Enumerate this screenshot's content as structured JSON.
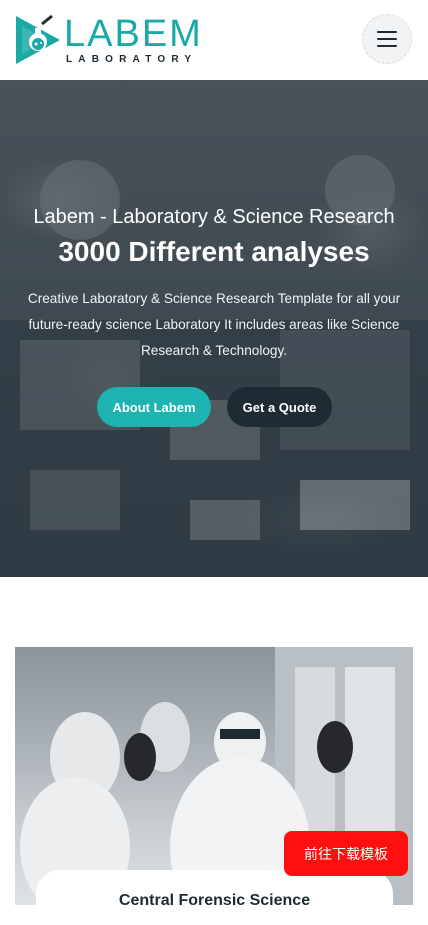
{
  "header": {
    "logo_word": "LABEM",
    "logo_sub": "LABORATORY",
    "brand_color": "#1aa9a6",
    "menu_icon": "hamburger-menu-icon"
  },
  "hero": {
    "subtitle": "Labem - Laboratory & Science Research",
    "title": "3000 Different analyses",
    "description": "Creative Laboratory & Science Research Template for all your future-ready science Laboratory It includes areas like Science Research & Technology.",
    "buttons": {
      "about": "About Labem",
      "quote": "Get a Quote"
    }
  },
  "service_card": {
    "title": "Central Forensic Science"
  },
  "floating": {
    "download_label": "前往下载模板",
    "color": "#ff1010"
  },
  "colors": {
    "accent": "#1db3b0",
    "dark": "#1f2b33"
  }
}
